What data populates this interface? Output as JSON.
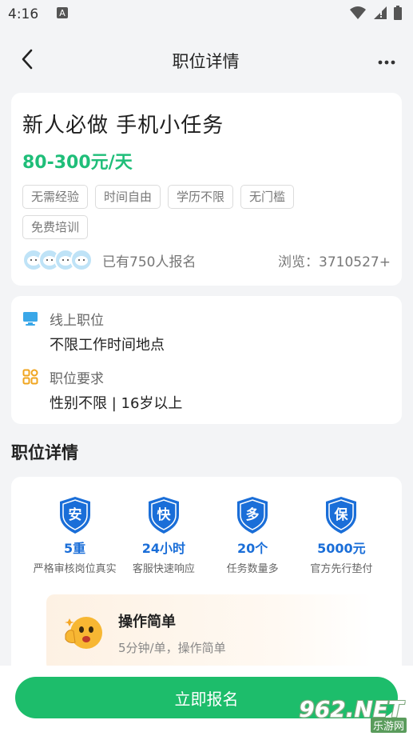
{
  "status": {
    "time": "4:16",
    "notification_icon": "a-letter-icon"
  },
  "nav": {
    "title": "职位详情"
  },
  "job": {
    "title": "新人必做 手机小任务",
    "salary": "80-300元/天",
    "tags": [
      "无需经验",
      "时间自由",
      "学历不限",
      "无门槛",
      "免费培训"
    ],
    "signup_text": "已有750人报名",
    "views_text": "浏览：3710527+"
  },
  "info": {
    "location_label": "线上职位",
    "location_value": "不限工作时间地点",
    "requirement_label": "职位要求",
    "requirement_value": "性别不限 | 16岁以上"
  },
  "section": {
    "title": "职位详情"
  },
  "features": [
    {
      "badge": "安",
      "value": "5重",
      "desc": "严格审核岗位真实"
    },
    {
      "badge": "快",
      "value": "24小时",
      "desc": "客服快速响应"
    },
    {
      "badge": "多",
      "value": "20个",
      "desc": "任务数量多"
    },
    {
      "badge": "保",
      "value": "5000元",
      "desc": "官方先行垫付"
    }
  ],
  "operation": {
    "title": "操作简单",
    "desc": "5分钟/单，操作简单"
  },
  "bottom": {
    "apply_label": "立即报名"
  },
  "watermark": {
    "text": "962.NET",
    "sub": "乐游网"
  },
  "colors": {
    "accent_green": "#1fbe79",
    "button_green": "#1dbd6b",
    "badge_blue": "#1a6ed8"
  }
}
